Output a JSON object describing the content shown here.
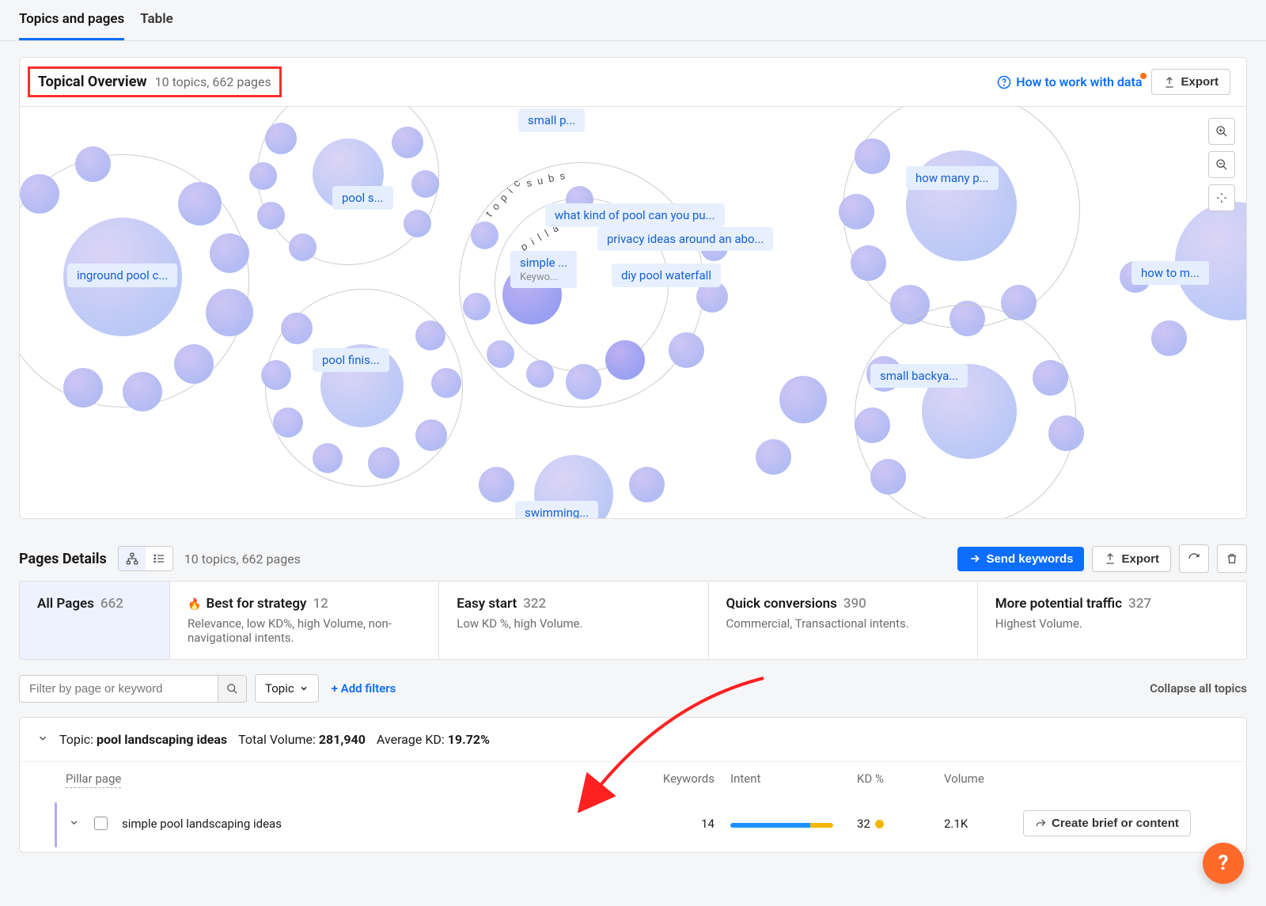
{
  "tabs": {
    "topics": "Topics and pages",
    "table": "Table"
  },
  "overview": {
    "title": "Topical Overview",
    "subtitle": "10 topics, 662 pages",
    "help_link": "How to work with data",
    "export": "Export"
  },
  "chips": {
    "small_p": "small p...",
    "pool_s": "pool s...",
    "what_kind": "what kind of pool can you pu...",
    "privacy": "privacy ideas around an abo...",
    "simple": "simple ...",
    "simple_sub": "Keywo...",
    "diy": "diy pool waterfall",
    "inground": "inground pool c...",
    "pool_finish": "pool finis...",
    "how_many": "how many p...",
    "how_to_m": "how to m...",
    "small_backya": "small backya...",
    "swimming": "swimming...",
    "arc_pillar": "p i l l a r",
    "arc_topic": "t o p i c",
    "arc_subs": "s u b s"
  },
  "pages": {
    "title": "Pages Details",
    "subtitle": "10 topics, 662 pages",
    "send": "Send keywords",
    "export": "Export"
  },
  "ftabs": {
    "all_label": "All Pages",
    "all_count": "662",
    "best_label": "Best for strategy",
    "best_count": "12",
    "best_desc": "Relevance, low KD%, high Volume, non-navigational intents.",
    "easy_label": "Easy start",
    "easy_count": "322",
    "easy_desc": "Low KD %, high Volume.",
    "quick_label": "Quick conversions",
    "quick_count": "390",
    "quick_desc": "Commercial, Transactional intents.",
    "more_label": "More potential traffic",
    "more_count": "327",
    "more_desc": "Highest Volume."
  },
  "filters": {
    "placeholder": "Filter by page or keyword",
    "topic": "Topic",
    "add": "+ Add filters",
    "collapse": "Collapse all topics"
  },
  "topic": {
    "prefix": "Topic:",
    "name": "pool landscaping ideas",
    "tv_label": "Total Volume:",
    "tv_value": "281,940",
    "akd_label": "Average KD:",
    "akd_value": "19.72%"
  },
  "cols": {
    "pillar": "Pillar page",
    "kw": "Keywords",
    "intent": "Intent",
    "kd": "KD %",
    "vol": "Volume"
  },
  "row": {
    "name": "simple pool landscaping ideas",
    "kw": "14",
    "kd": "32",
    "vol": "2.1K",
    "action": "Create brief or content"
  }
}
